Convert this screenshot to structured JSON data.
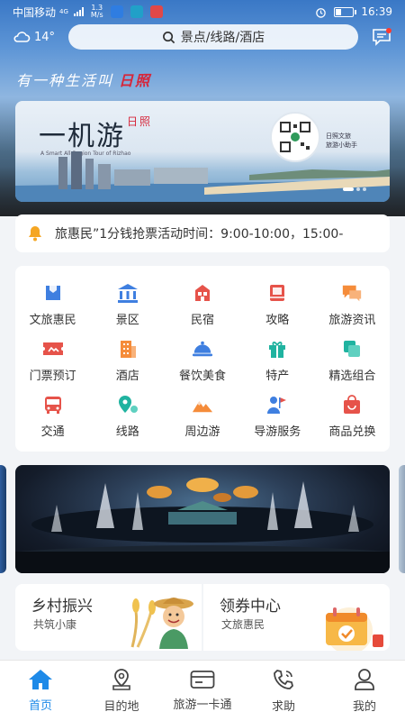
{
  "status_bar": {
    "carrier": "中国移动",
    "network": "4G",
    "speed_top": "1.3",
    "speed_bottom": "M/s",
    "time": "16:39"
  },
  "top_bar": {
    "weather": "14°",
    "search_placeholder": "景点/线路/酒店"
  },
  "hero": {
    "slogan": "有一种生活叫",
    "slogan_brand": "日照"
  },
  "banner": {
    "title": "一机游",
    "title_brand": "日照",
    "subtitle": "A Smart All-Region Tour of Rizhao",
    "qr_caption_1": "日照文旅",
    "qr_caption_2": "旅游小助手",
    "slide_count": 3,
    "active_slide": 1
  },
  "notice": {
    "text": "旅惠民”1分钱抢票活动时间：9:00-10:00，15:00-"
  },
  "grid": {
    "items": [
      {
        "label": "文旅惠民",
        "icon": "ticket-icon",
        "color": "#3f7fe0"
      },
      {
        "label": "景区",
        "icon": "temple-icon",
        "color": "#3f7fe0"
      },
      {
        "label": "民宿",
        "icon": "house-icon",
        "color": "#e6534a"
      },
      {
        "label": "攻略",
        "icon": "book-icon",
        "color": "#e6534a"
      },
      {
        "label": "旅游资讯",
        "icon": "chat-bubbles-icon",
        "color": "#f58c3a"
      },
      {
        "label": "门票预订",
        "icon": "admission-ticket-icon",
        "color": "#e6534a"
      },
      {
        "label": "酒店",
        "icon": "hotel-icon",
        "color": "#f58c3a"
      },
      {
        "label": "餐饮美食",
        "icon": "cloche-icon",
        "color": "#3f7fe0"
      },
      {
        "label": "特产",
        "icon": "gift-icon",
        "color": "#20b3a0"
      },
      {
        "label": "精选组合",
        "icon": "layers-icon",
        "color": "#20b3a0"
      },
      {
        "label": "交通",
        "icon": "bus-icon",
        "color": "#e6534a"
      },
      {
        "label": "线路",
        "icon": "route-pin-icon",
        "color": "#20b3a0"
      },
      {
        "label": "周边游",
        "icon": "mountain-icon",
        "color": "#f58c3a"
      },
      {
        "label": "导游服务",
        "icon": "guide-icon",
        "color": "#3f7fe0"
      },
      {
        "label": "商品兑换",
        "icon": "shopping-bag-icon",
        "color": "#e6534a"
      }
    ]
  },
  "promos": {
    "left": {
      "title": "乡村振兴",
      "subtitle": "共筑小康"
    },
    "right": {
      "title": "领券中心",
      "subtitle": "文旅惠民"
    }
  },
  "bottom_nav": {
    "items": [
      {
        "label": "首页",
        "icon": "home-icon",
        "active": true
      },
      {
        "label": "目的地",
        "icon": "location-pin-icon",
        "active": false
      },
      {
        "label": "旅游一卡通",
        "icon": "card-icon",
        "active": false
      },
      {
        "label": "求助",
        "icon": "phone-icon",
        "active": false
      },
      {
        "label": "我的",
        "icon": "user-icon",
        "active": false
      }
    ]
  },
  "colors": {
    "accent": "#1e8ae8",
    "alert": "#d6263a",
    "notice_bell": "#f5a623"
  }
}
